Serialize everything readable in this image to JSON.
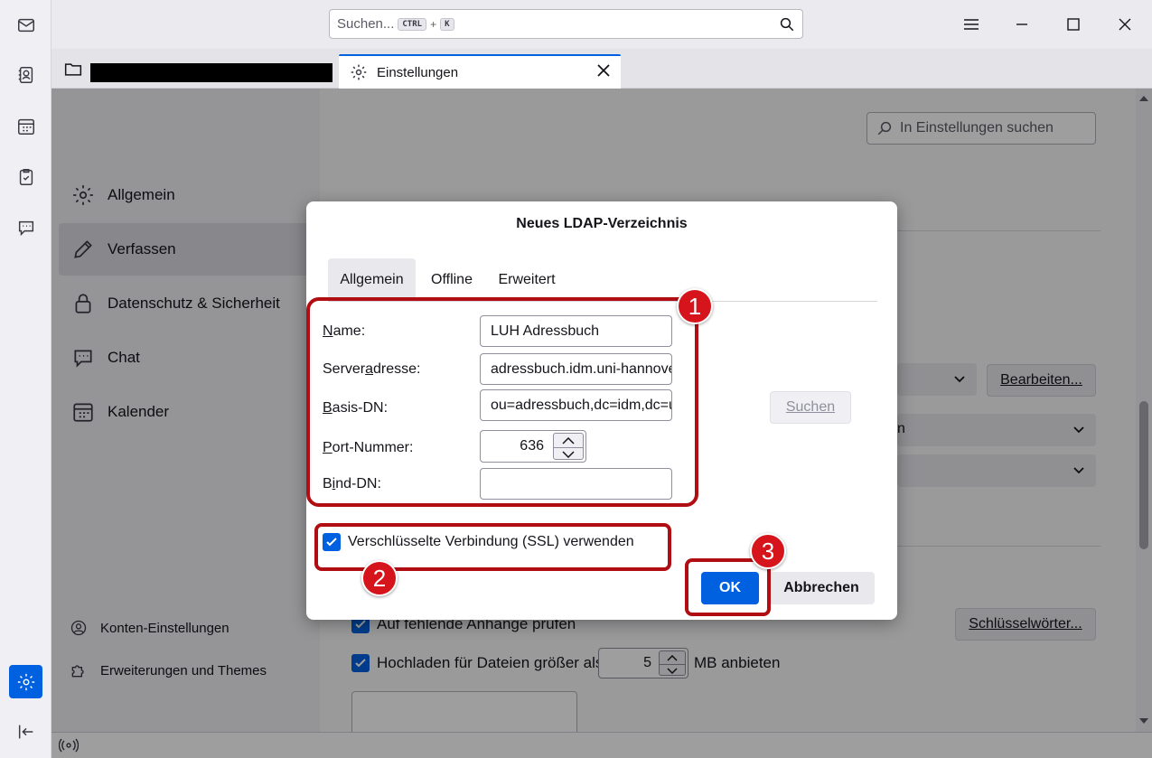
{
  "titlebar": {
    "search_placeholder": "Suchen...",
    "shortcut_key1": "CTRL",
    "shortcut_plus": "+",
    "shortcut_key2": "K"
  },
  "tabs": {
    "active_tab_title": "Einstellungen"
  },
  "sidebar": {
    "items": [
      {
        "label": "Allgemein",
        "icon": "gear-icon"
      },
      {
        "label": "Verfassen",
        "icon": "pencil-icon"
      },
      {
        "label": "Datenschutz & Sicherheit",
        "icon": "lock-icon"
      },
      {
        "label": "Chat",
        "icon": "chat-icon"
      },
      {
        "label": "Kalender",
        "icon": "calendar-icon"
      }
    ],
    "footer": [
      {
        "label": "Konten-Einstellungen",
        "icon": "account-icon"
      },
      {
        "label": "Erweiterungen und Themes",
        "icon": "puzzle-icon"
      }
    ]
  },
  "prefs": {
    "search_placeholder": "In Einstellungen suchen",
    "bearbeiten_label": "Bearbeiten...",
    "dropdown_partial_text": "n",
    "attach_reminder_label": "Auf fehlende Anhänge prüfen",
    "keywords_label": "Schlüsselwörter...",
    "upload_label": "Hochladen für Dateien größer als",
    "upload_value": "5",
    "upload_unit": "MB anbieten"
  },
  "dialog": {
    "title": "Neues LDAP-Verzeichnis",
    "tabs": [
      "Allgemein",
      "Offline",
      "Erweitert"
    ],
    "active_tab": "Allgemein",
    "fields": {
      "name_label": "Name:",
      "name_value": "LUH Adressbuch",
      "server_label": "Serveradresse:",
      "server_value": "adressbuch.idm.uni-hannover.de",
      "basedn_label": "Basis-DN:",
      "basedn_value": "ou=adressbuch,dc=idm,dc=uni-hannover,dc=de",
      "port_label": "Port-Nummer:",
      "port_value": "636",
      "binddn_label": "Bind-DN:",
      "binddn_value": ""
    },
    "search_button": "Suchen",
    "ssl_label": "Verschlüsselte Verbindung (SSL) verwenden",
    "ssl_checked": true,
    "ok_button": "OK",
    "cancel_button": "Abbrechen"
  },
  "annotations": {
    "marker1": "1",
    "marker2": "2",
    "marker3": "3",
    "color": "#b00e12"
  },
  "colors": {
    "accent": "#0061e0"
  }
}
